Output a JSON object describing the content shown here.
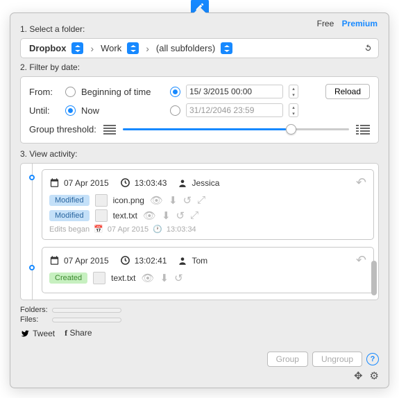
{
  "header": {
    "free_label": "Free",
    "premium_label": "Premium"
  },
  "section1": {
    "label": "1. Select a folder:",
    "crumbs": [
      "Dropbox",
      "Work",
      "(all subfolders)"
    ]
  },
  "section2": {
    "label": "2. Filter by date:",
    "from_label": "From:",
    "until_label": "Until:",
    "beginning_label": "Beginning of time",
    "now_label": "Now",
    "from_value": "15/ 3/2015 00:00",
    "until_value": "31/12/2046 23:59",
    "reload_label": "Reload",
    "threshold_label": "Group threshold:"
  },
  "section3": {
    "label": "3. View activity:",
    "events": [
      {
        "date": "07 Apr 2015",
        "time": "13:03:43",
        "user": "Jessica",
        "files": [
          {
            "action": "Modified",
            "action_type": "mod",
            "name": "icon.png"
          },
          {
            "action": "Modified",
            "action_type": "mod",
            "name": "text.txt"
          }
        ],
        "edits_label": "Edits began",
        "edits_date": "07 Apr 2015",
        "edits_time": "13:03:34"
      },
      {
        "date": "07 Apr 2015",
        "time": "13:02:41",
        "user": "Tom",
        "files": [
          {
            "action": "Created",
            "action_type": "cre",
            "name": "text.txt"
          }
        ]
      }
    ]
  },
  "footer": {
    "folders_label": "Folders:",
    "files_label": "Files:",
    "group_label": "Group",
    "ungroup_label": "Ungroup",
    "tweet_label": "Tweet",
    "share_label": "Share"
  },
  "colors": {
    "accent": "#1789ff"
  }
}
